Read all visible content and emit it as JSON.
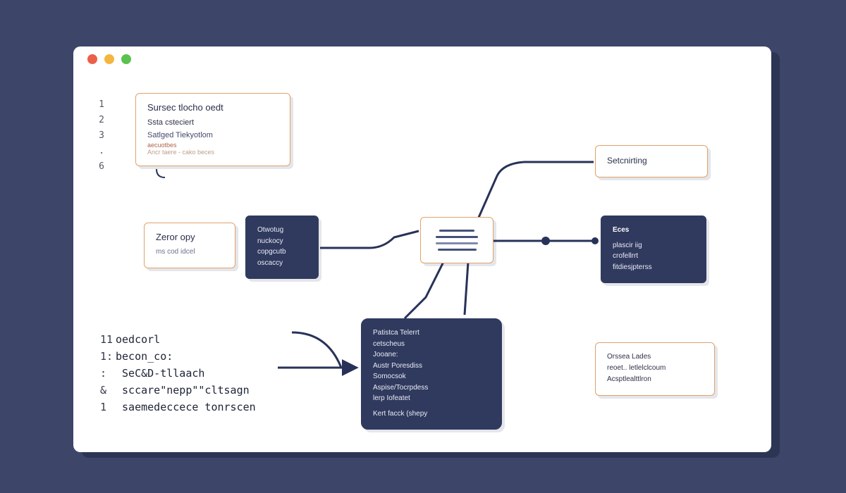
{
  "gutter": [
    "1",
    "2",
    "3",
    ".",
    "6"
  ],
  "cards": {
    "header": {
      "t": "Sursec tlocho oedt",
      "a": "Ssta csteciert",
      "b": "Satlged Tiekyotlom",
      "c": "aecuotbes",
      "d": "Ancr taere - cako beces"
    },
    "zero": {
      "t": "Zeror opy",
      "s": "ms cod idcel"
    },
    "small": {
      "a": "Otwotug",
      "b": "nuckocy",
      "c": "copgcutb",
      "d": "oscaccy"
    },
    "setc": {
      "t": "Setcnirting"
    },
    "right": {
      "a": "Eces",
      "b": "plascir iig",
      "c": "crofellrrt",
      "d": "fitdiesjpterss"
    },
    "big": {
      "l": [
        "Patistca Telerrt",
        "cetscheus",
        "Jooane:",
        "Austr Poresdiss",
        "Somocsok",
        "Aspise/Tocrpdess",
        "lerp Iofeatet",
        "Kert facck (shepy"
      ]
    },
    "bottom": {
      "a": "Orssea Lades",
      "b": "reoet.. letlelclcoum",
      "c": "Acsptlealttlron"
    }
  },
  "code": {
    "l1": {
      "n": "11",
      "t": "oedcorl"
    },
    "l2": {
      "n": "1:",
      "t": "becon_co:"
    },
    "l3": {
      "n": ":",
      "t": " SeC&D-tllaach"
    },
    "l4": {
      "n": "&",
      "t": " sccare\"nepp\"\"cltsagn"
    },
    "l5": {
      "n": "1",
      "t": " saemedeccece tonrscen"
    }
  }
}
